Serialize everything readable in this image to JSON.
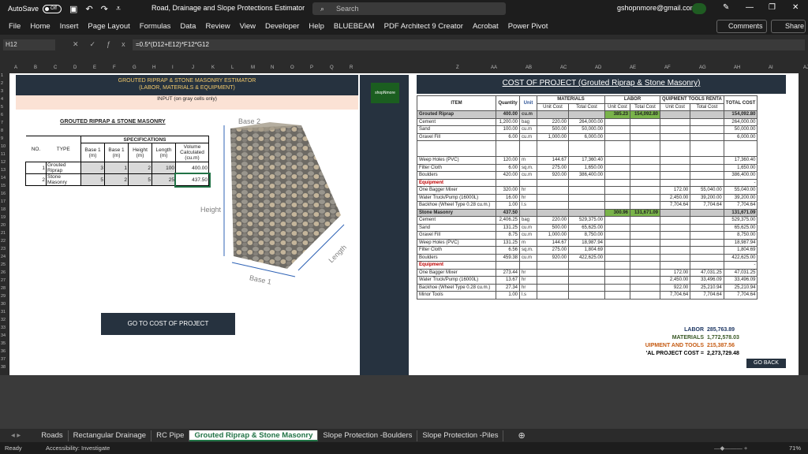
{
  "titlebar": {
    "autosave": "AutoSave",
    "toggle": "Off",
    "title": "Road, Drainage and Slope Protections Estimator",
    "search_placeholder": "Search",
    "account": "gshopnmore@gmail.com"
  },
  "menu": [
    "File",
    "Home",
    "Insert",
    "Page Layout",
    "Formulas",
    "Data",
    "Review",
    "View",
    "Developer",
    "Help",
    "BLUEBEAM",
    "PDF Architect 9 Creator",
    "Acrobat",
    "Power Pivot"
  ],
  "comments": "Comments",
  "share": "Share",
  "namebox": "H12",
  "formula": "=0.5*(D12+E12)*F12*G12",
  "columns_left": [
    "A",
    "B",
    "C",
    "D",
    "E",
    "F",
    "G",
    "H",
    "I",
    "J",
    "K",
    "L",
    "M",
    "N",
    "O",
    "P",
    "Q",
    "R"
  ],
  "columns_right": [
    "Z",
    "AA",
    "AB",
    "AC",
    "AD",
    "AE",
    "AF",
    "AG",
    "AH",
    "AI",
    "AJ"
  ],
  "left": {
    "title1": "GROUTED RIPRAP & STONE MASONRY ESTIMATOR",
    "title2": "(LABOR, MATERIALS & EQUIPMENT)",
    "input_note": "INPUT (on gray cells only)",
    "section": "GROUTED RIPRAP & STONE MASONRY",
    "spec_header": "SPECIFICATIONS",
    "headers": [
      "NO.",
      "TYPE",
      "Base 1 (m)",
      "Base 1 (m)",
      "Height (m)",
      "Length (m)",
      "Volume Calculated (cu.m)"
    ],
    "rows": [
      [
        "1",
        "Grouted Riprap",
        "3",
        "1",
        "2",
        "100",
        "400.00"
      ],
      [
        "2",
        "Stone Masonry",
        "5",
        "2",
        "5",
        "25",
        "437.50"
      ]
    ],
    "go_button": "GO TO COST OF PROJECT",
    "fig_base2": "Base 2",
    "fig_height": "Height",
    "fig_base1": "Base 1",
    "fig_length": "Length"
  },
  "logo_text": "shopNmore",
  "right": {
    "title": "COST OF PROJECT (Grouted Riprap & Stone Masonry)",
    "group_headers": {
      "item": "ITEM",
      "quantity": "Quantity",
      "unit": "Unit",
      "materials": "MATERIALS",
      "labor": "LABOR",
      "equipment": "QUIPMENT TOOLS RENTA",
      "total": "TOTAL COST"
    },
    "sub_headers": [
      "Unit Cost",
      "Total Cost",
      "Unit Cost",
      "Total Cost",
      "Unit Cost",
      "Total Cost"
    ],
    "rows": [
      {
        "item": "Grouted Riprap",
        "q": "400.00",
        "u": "cu.m",
        "mu": "",
        "mt": "",
        "lu": "385.23",
        "lt": "154,092.80",
        "eu": "",
        "et": "",
        "t": "154,092.80",
        "type": "sec"
      },
      {
        "item": "Cement",
        "q": "1,200.00",
        "u": "bag",
        "mu": "220.00",
        "mt": "264,000.00",
        "lu": "",
        "lt": "",
        "eu": "",
        "et": "",
        "t": "264,000.00"
      },
      {
        "item": "Sand",
        "q": "100.00",
        "u": "cu.m",
        "mu": "500.00",
        "mt": "50,000.00",
        "lu": "",
        "lt": "",
        "eu": "",
        "et": "",
        "t": "50,000.00"
      },
      {
        "item": "Gravel Fill",
        "q": "6.00",
        "u": "cu.m",
        "mu": "1,000.00",
        "mt": "6,000.00",
        "lu": "",
        "lt": "",
        "eu": "",
        "et": "",
        "t": "6,000.00"
      },
      {
        "item": "",
        "q": "",
        "u": "",
        "mu": "",
        "mt": "",
        "lu": "",
        "lt": "",
        "eu": "",
        "et": "",
        "t": ""
      },
      {
        "item": "Weep Holes (PVC)",
        "q": "120.00",
        "u": "m",
        "mu": "144.67",
        "mt": "17,360.40",
        "lu": "",
        "lt": "",
        "eu": "",
        "et": "",
        "t": "17,360.40"
      },
      {
        "item": "Filter Cloth",
        "q": "6.00",
        "u": "sq.m.",
        "mu": "275.00",
        "mt": "1,650.00",
        "lu": "",
        "lt": "",
        "eu": "",
        "et": "",
        "t": "1,650.00"
      },
      {
        "item": "Boulders",
        "q": "420.00",
        "u": "cu.m",
        "mu": "920.00",
        "mt": "386,400.00",
        "lu": "",
        "lt": "",
        "eu": "",
        "et": "",
        "t": "386,400.00"
      },
      {
        "item": "Equipment",
        "q": "",
        "u": "",
        "mu": "",
        "mt": "",
        "lu": "",
        "lt": "",
        "eu": "",
        "et": "",
        "t": "-",
        "type": "eq"
      },
      {
        "item": "One Bagger Mixer",
        "q": "320.00",
        "u": "hr",
        "mu": "",
        "mt": "",
        "lu": "",
        "lt": "",
        "eu": "172.00",
        "et": "55,040.00",
        "t": "55,040.00"
      },
      {
        "item": "Water Truck/Pump (16000L)",
        "q": "16.00",
        "u": "hr",
        "mu": "",
        "mt": "",
        "lu": "",
        "lt": "",
        "eu": "2,450.00",
        "et": "39,200.00",
        "t": "39,200.00"
      },
      {
        "item": "Backhoe (Wheel Type 0.28 cu.m.)",
        "q": "1.00",
        "u": "l.s",
        "mu": "",
        "mt": "",
        "lu": "",
        "lt": "",
        "eu": "7,704.64",
        "et": "7,704.64",
        "t": "7,704.64"
      },
      {
        "item": "Stone Masonry",
        "q": "437.50",
        "u": "",
        "mu": "",
        "mt": "",
        "lu": "300.96",
        "lt": "131,671.09",
        "eu": "",
        "et": "",
        "t": "131,671.09",
        "type": "sec"
      },
      {
        "item": "Cement",
        "q": "2,406.25",
        "u": "bag",
        "mu": "220.00",
        "mt": "529,375.00",
        "lu": "",
        "lt": "",
        "eu": "",
        "et": "",
        "t": "529,375.00"
      },
      {
        "item": "Sand",
        "q": "131.25",
        "u": "cu.m",
        "mu": "500.00",
        "mt": "65,625.00",
        "lu": "",
        "lt": "",
        "eu": "",
        "et": "",
        "t": "65,625.00"
      },
      {
        "item": "Gravel Fill",
        "q": "8.75",
        "u": "cu.m",
        "mu": "1,000.00",
        "mt": "8,750.00",
        "lu": "",
        "lt": "",
        "eu": "",
        "et": "",
        "t": "8,750.00"
      },
      {
        "item": "Weep Holes (PVC)",
        "q": "131.25",
        "u": "m",
        "mu": "144.67",
        "mt": "18,987.94",
        "lu": "",
        "lt": "",
        "eu": "",
        "et": "",
        "t": "18,987.94"
      },
      {
        "item": "Filter Cloth",
        "q": "6.56",
        "u": "sq.m.",
        "mu": "275.00",
        "mt": "1,804.69",
        "lu": "",
        "lt": "",
        "eu": "",
        "et": "",
        "t": "1,804.69"
      },
      {
        "item": "Boulders",
        "q": "459.38",
        "u": "cu.m",
        "mu": "920.00",
        "mt": "422,625.00",
        "lu": "",
        "lt": "",
        "eu": "",
        "et": "",
        "t": "422,625.00"
      },
      {
        "item": "Equipment",
        "q": "",
        "u": "",
        "mu": "",
        "mt": "",
        "lu": "",
        "lt": "",
        "eu": "",
        "et": "",
        "t": "-",
        "type": "eq"
      },
      {
        "item": "One Bagger Mixer",
        "q": "273.44",
        "u": "hr",
        "mu": "",
        "mt": "",
        "lu": "",
        "lt": "",
        "eu": "172.00",
        "et": "47,031.25",
        "t": "47,031.25"
      },
      {
        "item": "Water Truck/Pump (16000L)",
        "q": "13.67",
        "u": "hr",
        "mu": "",
        "mt": "",
        "lu": "",
        "lt": "",
        "eu": "2,450.00",
        "et": "33,496.09",
        "t": "33,496.09"
      },
      {
        "item": "Backhoe (Wheel Type 0.28 cu.m.)",
        "q": "27.34",
        "u": "hr",
        "mu": "",
        "mt": "",
        "lu": "",
        "lt": "",
        "eu": "922.00",
        "et": "25,210.94",
        "t": "25,210.94"
      },
      {
        "item": "Minor Tools",
        "q": "1.00",
        "u": "l.s",
        "mu": "",
        "mt": "",
        "lu": "",
        "lt": "",
        "eu": "7,704.64",
        "et": "7,704.64",
        "t": "7,704.64"
      }
    ],
    "summary": [
      {
        "label": "LABOR",
        "value": "285,763.89",
        "color": "#1f3864"
      },
      {
        "label": "MATERIALS",
        "value": "1,772,578.03",
        "color": "#375623"
      },
      {
        "label": "UIPMENT AND TOOLS",
        "value": "215,387.56",
        "color": "#c55a11"
      },
      {
        "label": "'AL PROJECT COST =",
        "value": "2,273,729.48",
        "color": "#000000"
      }
    ],
    "go_back": "GO BACK"
  },
  "tabs": [
    "Roads",
    "Rectangular Drainage",
    "RC Pipe",
    "Grouted Riprap & Stone Masonry",
    "Slope Protection -Boulders",
    "Slope Protection -Piles"
  ],
  "status": {
    "ready": "Ready",
    "accessibility": "Accessibility: Investigate",
    "zoom": "71%"
  }
}
